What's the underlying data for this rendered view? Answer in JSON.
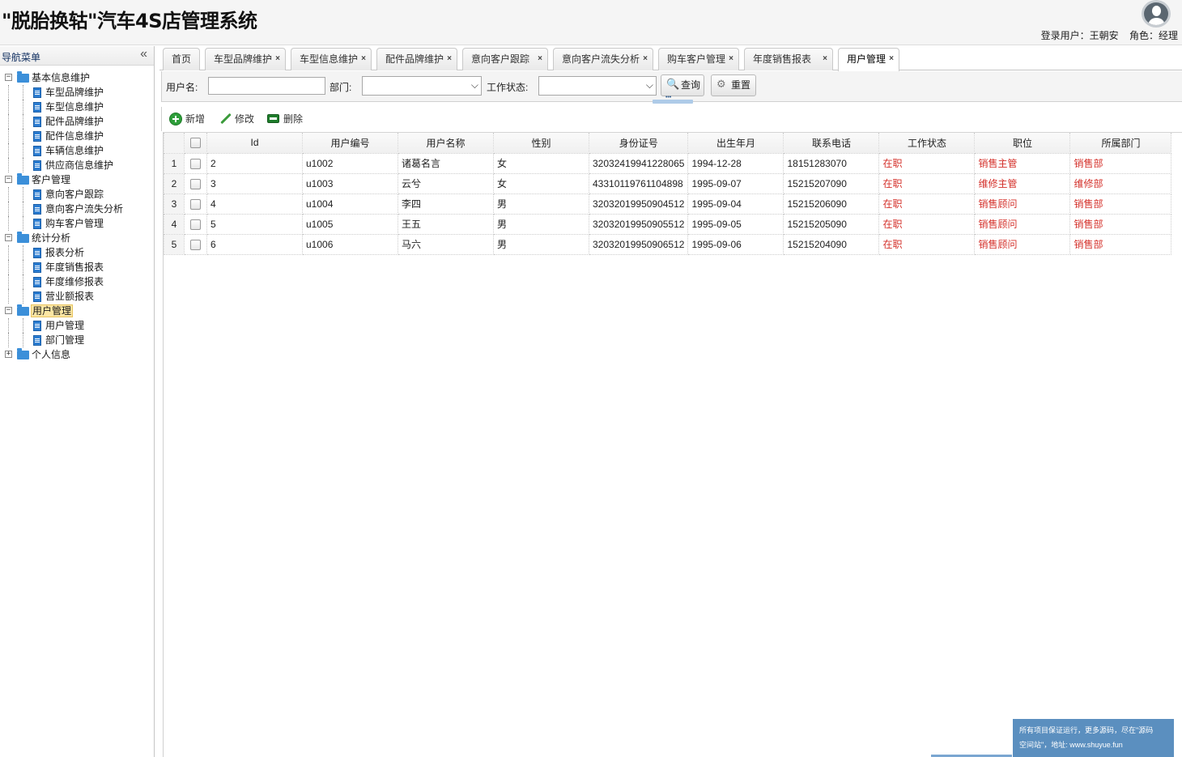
{
  "header": {
    "title": "\"脱胎换轱\"汽车4S店管理系统",
    "user_label": "登录用户：王朝安",
    "role_label": "角色：经理"
  },
  "sidebar": {
    "title": "导航菜单",
    "groups": [
      {
        "label": "基本信息维护",
        "items": [
          "车型品牌维护",
          "车型信息维护",
          "配件品牌维护",
          "配件信息维护",
          "车辆信息维护",
          "供应商信息维护"
        ]
      },
      {
        "label": "客户管理",
        "items": [
          "意向客户跟踪",
          "意向客户流失分析",
          "购车客户管理"
        ]
      },
      {
        "label": "统计分析",
        "items": [
          "报表分析",
          "年度销售报表",
          "年度维修报表",
          "营业额报表"
        ]
      },
      {
        "label": "用户管理",
        "items": [
          "用户管理",
          "部门管理"
        ]
      },
      {
        "label": "个人信息",
        "items": []
      }
    ]
  },
  "tabs": [
    "首页",
    "车型品牌维护",
    "车型信息维护",
    "配件品牌维护",
    "意向客户跟踪",
    "意向客户流失分析",
    "购车客户管理",
    "年度销售报表",
    "用户管理"
  ],
  "active_tab": "用户管理",
  "search": {
    "username_label": "用户名:",
    "username_value": "",
    "dept_label": "部门:",
    "dept_value": "",
    "status_label": "工作状态:",
    "status_value": "",
    "query_button": "查询",
    "reset_button": "重置"
  },
  "toolbar": {
    "add_label": "新增",
    "edit_label": "修改",
    "delete_label": "删除"
  },
  "table": {
    "columns": [
      "Id",
      "用户编号",
      "用户名称",
      "性别",
      "身份证号",
      "出生年月",
      "联系电话",
      "工作状态",
      "职位",
      "所属部门"
    ],
    "rows": [
      [
        "2",
        "u1002",
        "诸葛名言",
        "女",
        "32032419941228065",
        "1994-12-28",
        "18151283070",
        "在职",
        "销售主管",
        "销售部"
      ],
      [
        "3",
        "u1003",
        "云兮",
        "女",
        "43310119761104898",
        "1995-09-07",
        "15215207090",
        "在职",
        "维修主管",
        "维修部"
      ],
      [
        "4",
        "u1004",
        "李四",
        "男",
        "32032019950904512",
        "1995-09-04",
        "15215206090",
        "在职",
        "销售顾问",
        "销售部"
      ],
      [
        "5",
        "u1005",
        "王五",
        "男",
        "32032019950905512",
        "1995-09-05",
        "15215205090",
        "在职",
        "销售顾问",
        "销售部"
      ],
      [
        "6",
        "u1006",
        "马六",
        "男",
        "32032019950906512",
        "1995-09-06",
        "15215204090",
        "在职",
        "销售顾问",
        "销售部"
      ]
    ]
  },
  "notice": {
    "line1": "所有项目保证运行，更多源码，尽在\"源码",
    "line2": "空间站\"，地址: www.shuyue.fun"
  },
  "colors": {
    "accent": "#3b8fd9",
    "status_red": "#d4302a",
    "notice_bg": "#5b8fbf"
  }
}
